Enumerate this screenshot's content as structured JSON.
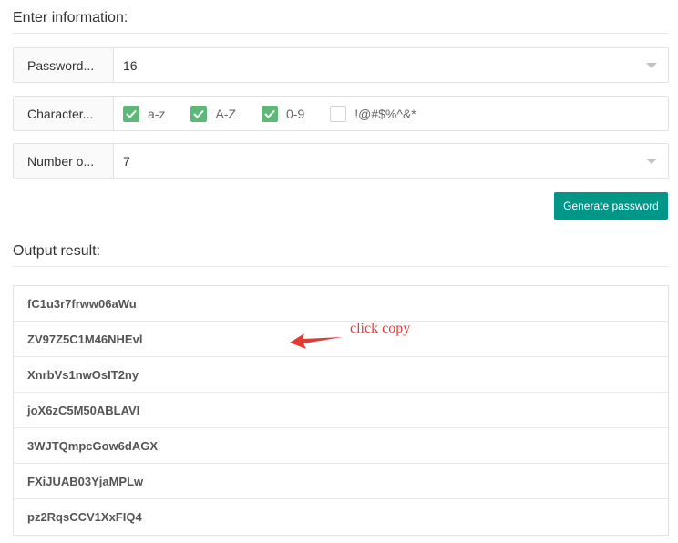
{
  "header": {
    "title": "Enter information:"
  },
  "form": {
    "password_length": {
      "label": "Password...",
      "value": "16"
    },
    "characters": {
      "label": "Character...",
      "options": [
        {
          "label": "a-z",
          "checked": true
        },
        {
          "label": "A-Z",
          "checked": true
        },
        {
          "label": "0-9",
          "checked": true
        },
        {
          "label": "!@#$%^&*",
          "checked": false
        }
      ]
    },
    "number_of": {
      "label": "Number o...",
      "value": "7"
    },
    "generate_label": "Generate password"
  },
  "output": {
    "title": "Output result:",
    "passwords": [
      "fC1u3r7frww06aWu",
      "ZV97Z5C1M46NHEvl",
      "XnrbVs1nwOsIT2ny",
      "joX6zC5M50ABLAVI",
      "3WJTQmpcGow6dAGX",
      "FXiJUAB03YjaMPLw",
      "pz2RqsCCV1XxFIQ4"
    ]
  },
  "annotation": {
    "text": "click copy"
  },
  "colors": {
    "accent": "#009688",
    "checkbox": "#5fb878",
    "annotation": "#e53935"
  }
}
